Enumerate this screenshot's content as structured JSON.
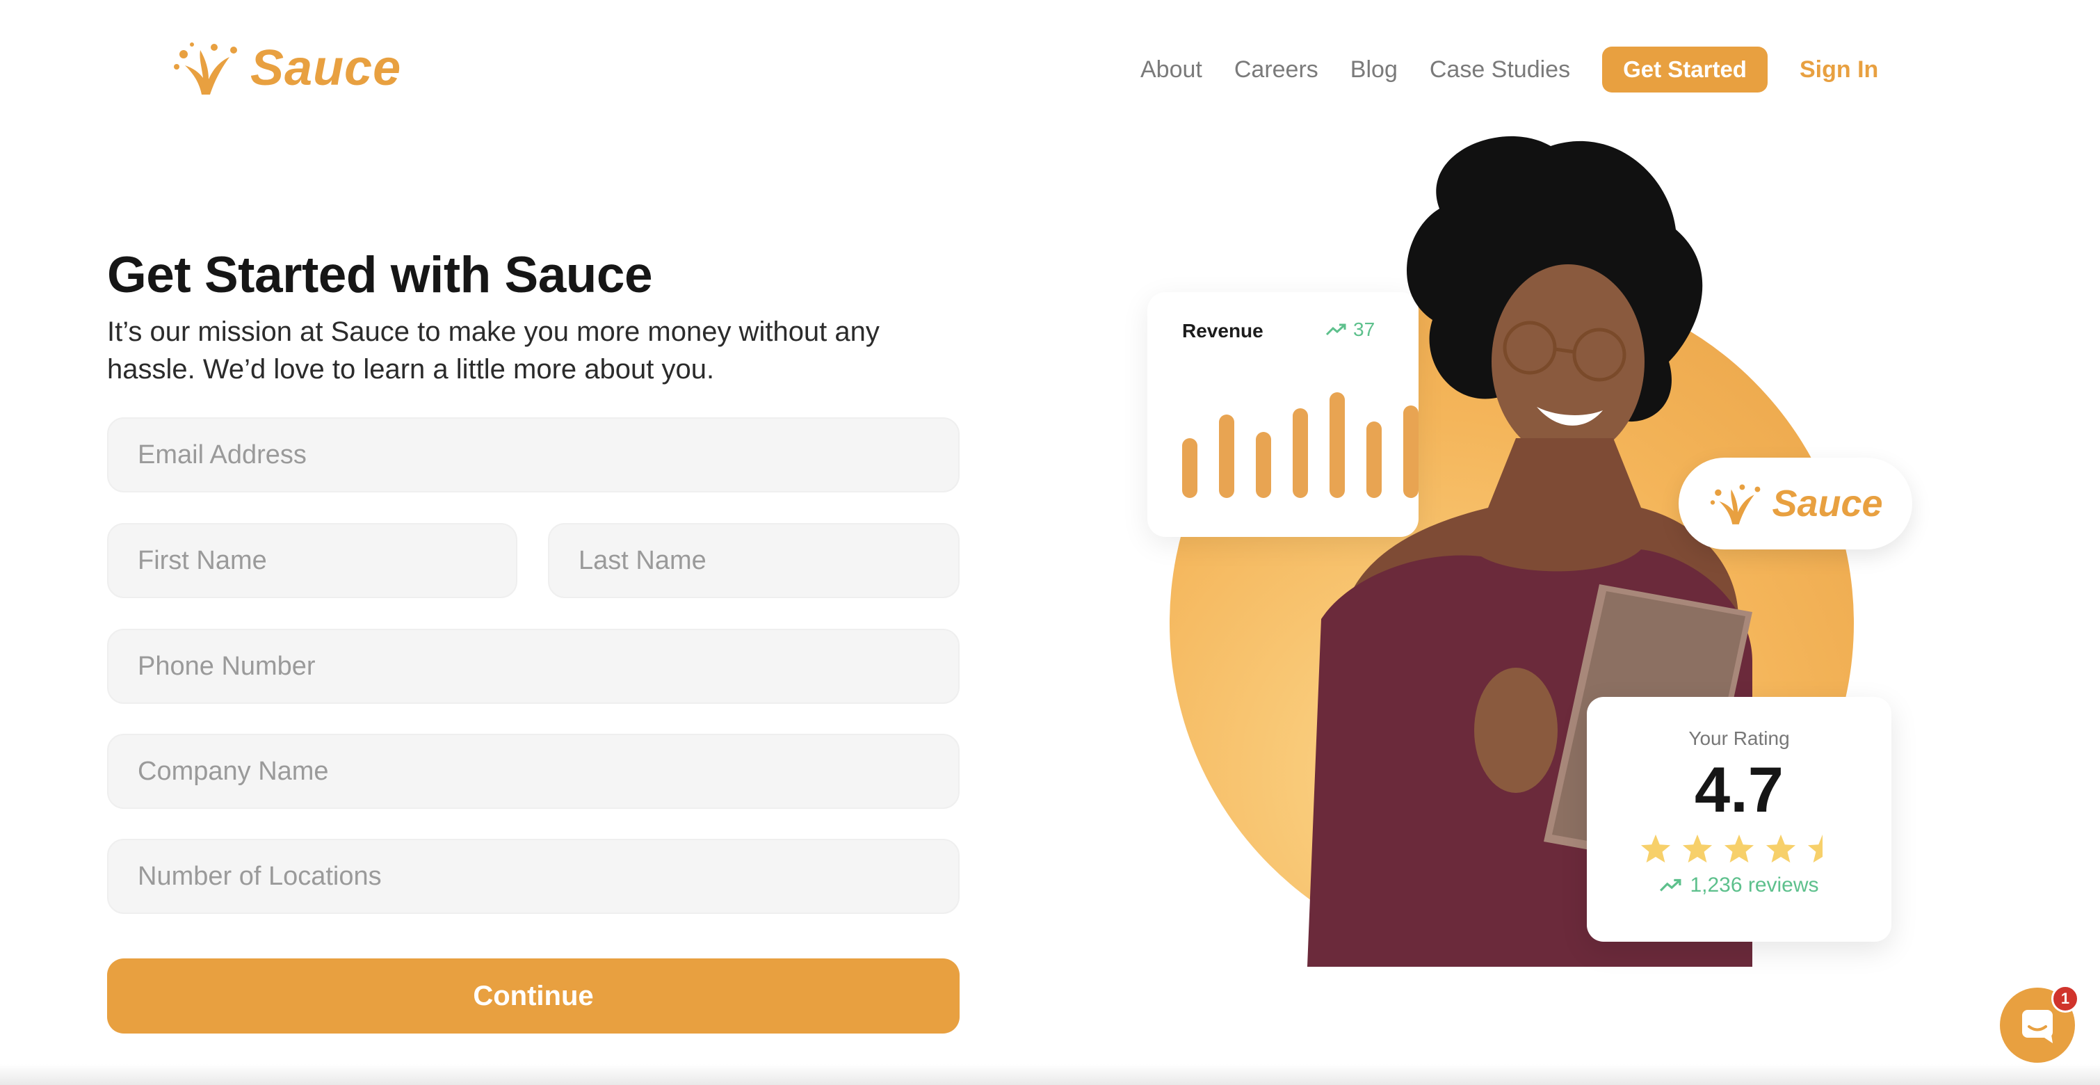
{
  "header": {
    "logo_text": "Sauce",
    "nav": [
      "About",
      "Careers",
      "Blog",
      "Case Studies"
    ],
    "cta_label": "Get Started",
    "signin_label": "Sign In"
  },
  "hero": {
    "title": "Get Started with Sauce",
    "subtitle": "It’s our mission at Sauce to make you more money without any hassle. We’d love to learn a little more about you."
  },
  "form": {
    "email_placeholder": "Email Address",
    "first_name_placeholder": "First Name",
    "last_name_placeholder": "Last Name",
    "phone_placeholder": "Phone Number",
    "company_placeholder": "Company Name",
    "locations_placeholder": "Number of Locations",
    "submit_label": "Continue"
  },
  "revenue_card": {
    "title": "Revenue",
    "trend_text": "37",
    "bar_levels": [
      0.45,
      0.63,
      0.5,
      0.68,
      0.8,
      0.58,
      0.7
    ]
  },
  "badge": {
    "text": "Sauce"
  },
  "rating_card": {
    "label": "Your Rating",
    "value": "4.7",
    "stars": 4.5,
    "reviews": "1,236 reviews"
  },
  "chat": {
    "unread_count": "1"
  },
  "colors": {
    "brand_orange": "#e8a040",
    "trend_green": "#5dc08c",
    "field_bg": "#f5f5f5"
  },
  "icons": [
    "sauce-splash-icon",
    "trend-up-icon",
    "star-icon",
    "chat-bubble-icon"
  ]
}
